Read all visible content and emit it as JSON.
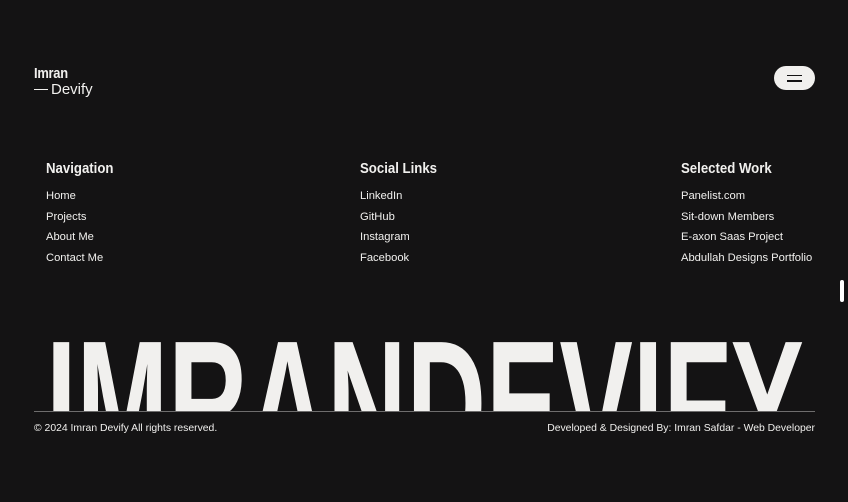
{
  "logo": {
    "top": "Imran",
    "bottom": "Devify"
  },
  "menu_button": {
    "icon": "hamburger-icon"
  },
  "columns": [
    {
      "title": "Navigation",
      "items": [
        "Home",
        "Projects",
        "About Me",
        "Contact Me"
      ]
    },
    {
      "title": "Social Links",
      "items": [
        "LinkedIn",
        "GitHub",
        "Instagram",
        "Facebook"
      ]
    },
    {
      "title": "Selected Work",
      "items": [
        "Panelist.com",
        "Sit-down Members",
        "E-axon Saas Project",
        "Abdullah Designs Portfolio"
      ]
    }
  ],
  "big_wordmark": "IMRANDEVIFY",
  "footer": {
    "copyright": "© 2024 Imran Devify All rights reserved.",
    "credit": "Developed & Designed By: Imran Safdar - Web Developer"
  },
  "colors": {
    "background": "#141314",
    "foreground": "#f1f0ee"
  }
}
